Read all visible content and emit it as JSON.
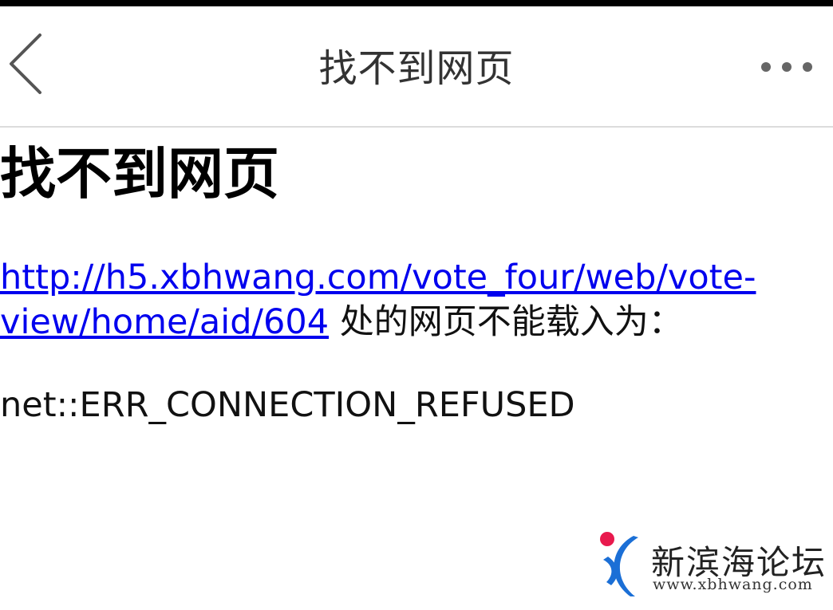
{
  "navbar": {
    "title": "找不到网页",
    "back_icon": "chevron-left-icon",
    "more_icon": "more-dots-icon"
  },
  "content": {
    "heading": "找不到网页",
    "failed_url": "http://h5.xbhwang.com/vote_four/web/vote-view/home/aid/604",
    "message_suffix": " 处的网页不能载入为：",
    "error_code": "net::ERR_CONNECTION_REFUSED"
  },
  "watermark": {
    "name": "新滨海论坛",
    "url": "www.xbhwang.com",
    "colors": {
      "dot": "#e8194d",
      "swoosh": "#1b6fd6"
    }
  },
  "colors": {
    "link": "#0000ee",
    "divider": "#dcdcdc",
    "status_strip": "#000000"
  }
}
